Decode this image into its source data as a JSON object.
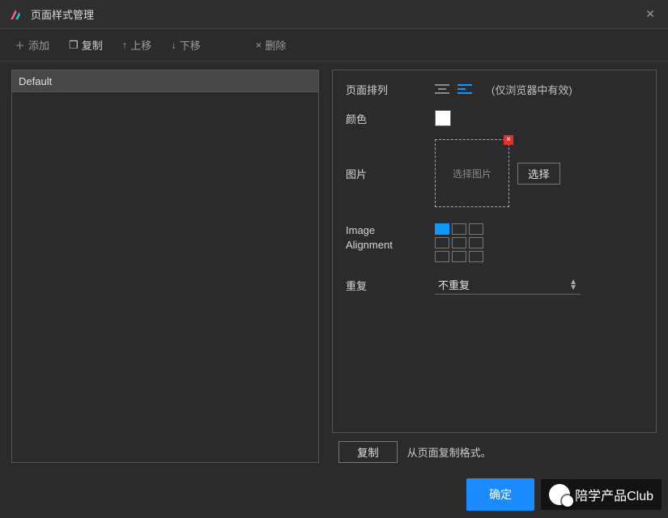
{
  "titlebar": {
    "title": "页面样式管理"
  },
  "toolbar": {
    "add": "添加",
    "duplicate": "复制",
    "move_up": "上移",
    "move_down": "下移",
    "delete": "删除"
  },
  "style_list": {
    "selected": "Default"
  },
  "props": {
    "page_alignment": {
      "label": "页面排列",
      "hint": "(仅浏览器中有效)"
    },
    "color": {
      "label": "颜色",
      "value": "#ffffff"
    },
    "image": {
      "label": "图片",
      "placeholder": "选择图片",
      "choose": "选择"
    },
    "image_alignment": {
      "label_line1": "Image",
      "label_line2": "Alignment"
    },
    "repeat": {
      "label": "重复",
      "value": "不重复"
    }
  },
  "right_bottom": {
    "copy": "复制",
    "copy_hint": "从页面复制格式。"
  },
  "footer": {
    "ok": "确定"
  },
  "watermark": "陪学产品Club"
}
